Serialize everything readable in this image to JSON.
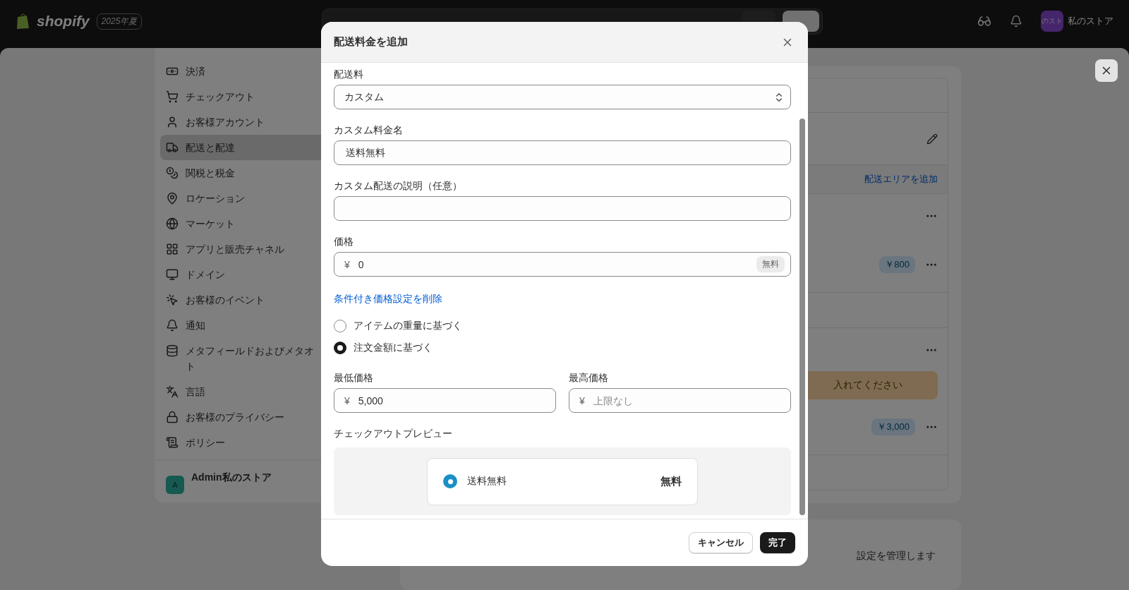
{
  "top_bar": {
    "logo": "shopify",
    "edition_badge": "2025年夏",
    "unsaved_bar": {
      "buttons": [
        {
          "kind": "secondary"
        },
        {
          "kind": "primary"
        }
      ]
    },
    "store": {
      "avatar_text": "のスト",
      "name": "私のストア"
    }
  },
  "sidebar": {
    "items": [
      {
        "lines": [
          "決済"
        ],
        "selected": false
      },
      {
        "lines": [
          "チェックアウト"
        ],
        "selected": false
      },
      {
        "lines": [
          "お客様アカウント"
        ],
        "selected": false
      },
      {
        "lines": [
          "配送と配達"
        ],
        "selected": true
      },
      {
        "lines": [
          "関税と税金"
        ],
        "selected": false
      },
      {
        "lines": [
          "ロケーション"
        ],
        "selected": false
      },
      {
        "lines": [
          "マーケット"
        ],
        "selected": false
      },
      {
        "lines": [
          "アプリと販売チャネル"
        ],
        "selected": false
      },
      {
        "lines": [
          "ドメイン"
        ],
        "selected": false
      },
      {
        "lines": [
          "お客様のイベント"
        ],
        "selected": false
      },
      {
        "lines": [
          "通知"
        ],
        "selected": false
      },
      {
        "lines": [
          "メタフィールドおよびメタオ",
          "ト"
        ],
        "selected": false
      },
      {
        "lines": [
          "言語"
        ],
        "selected": false
      },
      {
        "lines": [
          "お客様のプライバシー"
        ],
        "selected": false
      },
      {
        "lines": [
          "ポリシー"
        ],
        "selected": false
      }
    ],
    "account": {
      "avatar_letter": "A",
      "name": "Admin私のストア"
    }
  },
  "shipping_card": {
    "add_zone_link": "配送エリアを追加",
    "zones": [
      {
        "rates": [
          {
            "price": "￥800"
          }
        ]
      },
      {
        "warning": "入れてください",
        "rates": [
          {
            "price": "￥3,000"
          }
        ]
      }
    ]
  },
  "bottom_card": {
    "text": "設定を管理します"
  },
  "modal": {
    "title": "配送料金を追加",
    "fields": [
      {
        "kind": "select",
        "label": "配送料",
        "value": "カスタム"
      },
      {
        "kind": "text",
        "label": "カスタム料金名",
        "value": "送料無料"
      },
      {
        "kind": "text",
        "label": "カスタム配送の説明（任意）"
      },
      {
        "kind": "price",
        "label": "価格",
        "prefix": "¥",
        "value": "0",
        "tag": "無料"
      }
    ],
    "remove_link": "条件付き価格設定を削除",
    "conditions": [
      {
        "label": "アイテムの重量に基づく",
        "selected": false
      },
      {
        "label": "注文金額に基づく",
        "selected": true
      }
    ],
    "range": [
      {
        "label": "最低価格",
        "prefix": "¥",
        "value": "5,000"
      },
      {
        "label": "最高価格",
        "prefix": "¥",
        "placeholder": "上限なし"
      }
    ],
    "preview": {
      "label": "チェックアウトプレビュー",
      "option": {
        "name": "送料無料",
        "price": "無料",
        "selected": true
      }
    },
    "buttons": [
      {
        "label": "キャンセル",
        "kind": "secondary"
      },
      {
        "label": "完了",
        "kind": "primary"
      }
    ]
  }
}
